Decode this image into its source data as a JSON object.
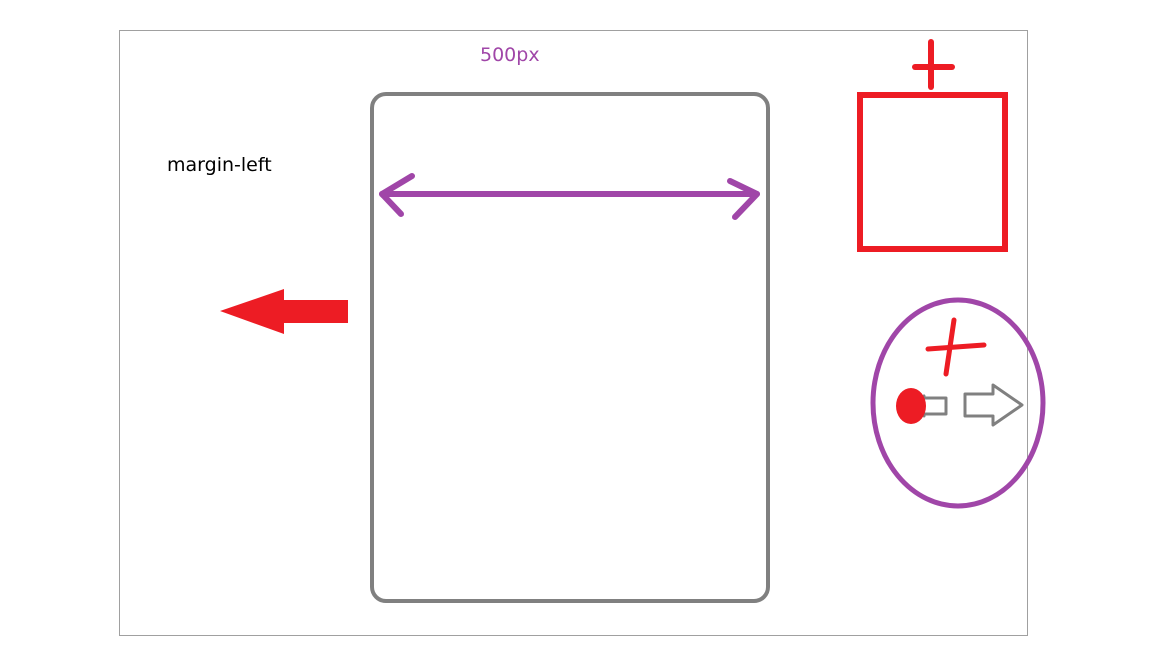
{
  "labels": {
    "width_label": "500px",
    "margin_label": "margin-left"
  },
  "colors": {
    "frame": "#a0a0a0",
    "box": "#808080",
    "accent_purple": "#a046a8",
    "accent_red": "#ed1c24"
  },
  "icons": {
    "arrow_left": "red-left-arrow-icon",
    "plus": "plus-icon",
    "arrow_right_outline": "outline-right-arrow-icon",
    "dot": "red-dot-icon"
  }
}
